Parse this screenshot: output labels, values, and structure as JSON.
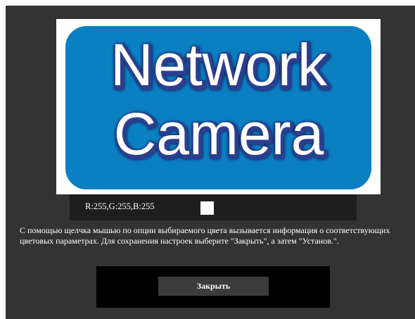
{
  "logo": {
    "line1": "Network",
    "line2": "Camera",
    "bg_color": "#0a80c2",
    "text_color": "#ffffff",
    "shadow_color": "#1a2a6e"
  },
  "color_info": {
    "rgb_label": "R:255,G:255,B:255",
    "swatch_color": "#ffffff"
  },
  "help_text": "С помощью щелчка мышью по опции выбираемого цвета вызывается информация о соответствующих цветовых параметрах. Для сохранения настроек выберите \"Закрыть\", а затем \"Установ.\".",
  "buttons": {
    "close_label": "Закрыть"
  }
}
